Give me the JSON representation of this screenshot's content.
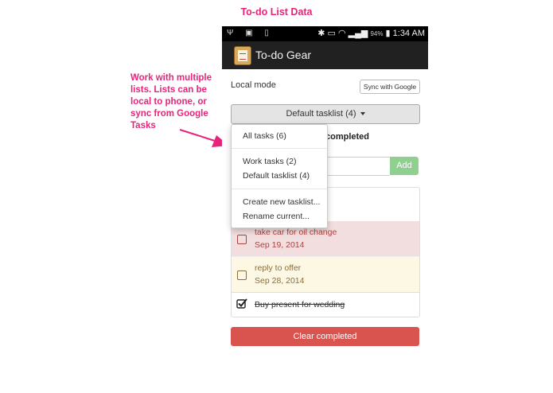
{
  "heading": "To-do List Data",
  "annotation": "Work with multiple lists. Lists can be local to phone, or sync from Google Tasks",
  "statusbar": {
    "icons_left": "Ψ ▣ ▯",
    "battery": "94%",
    "time": "1:34 AM"
  },
  "app": {
    "title": "To-do Gear"
  },
  "controls": {
    "mode_label": "Local mode",
    "sync_button": "Sync with Google",
    "list_selector": "Default tasklist (4)",
    "completed_text": "completed",
    "add_button": "Add",
    "clear_button": "Clear completed"
  },
  "dropdown": {
    "all_tasks": "All tasks (6)",
    "lists": [
      "Work tasks (2)",
      "Default tasklist (4)"
    ],
    "actions": [
      "Create new tasklist...",
      "Rename current..."
    ]
  },
  "tasks": [
    {
      "title": "take car for oil change",
      "date": "Sep 19, 2014",
      "status": "overdue",
      "color": "#a94442"
    },
    {
      "title": "reply to offer",
      "date": "Sep 28, 2014",
      "status": "due-soon",
      "color": "#8a6d3b"
    },
    {
      "title": "Buy present for wedding",
      "status": "completed"
    }
  ],
  "colors": {
    "annotation": "#e8247a",
    "add": "#8fcf8f",
    "clear": "#d9534f",
    "actionbar": "#212121"
  }
}
